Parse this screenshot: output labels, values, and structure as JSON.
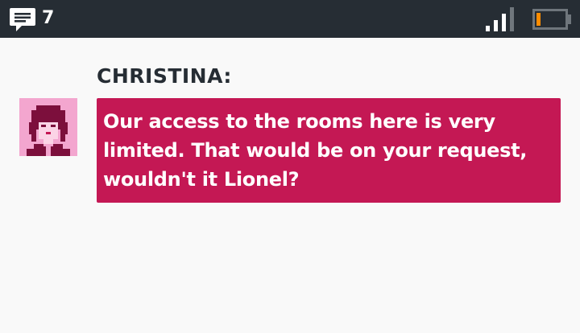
{
  "status_bar": {
    "message_count": "7",
    "icons": {
      "messages": "message-icon",
      "signal": "signal-icon",
      "battery": "battery-icon"
    },
    "colors": {
      "bar": "#262d34",
      "battery_level": "#ff8c00"
    },
    "battery_level": 0.15
  },
  "dialogue": {
    "speaker": "CHRISTINA:",
    "text": "Our access to the rooms here is very limited. That would be on your request, wouldn't it Lionel?",
    "avatar_icon": "christina-portrait",
    "bubble_color": "#c41854"
  }
}
